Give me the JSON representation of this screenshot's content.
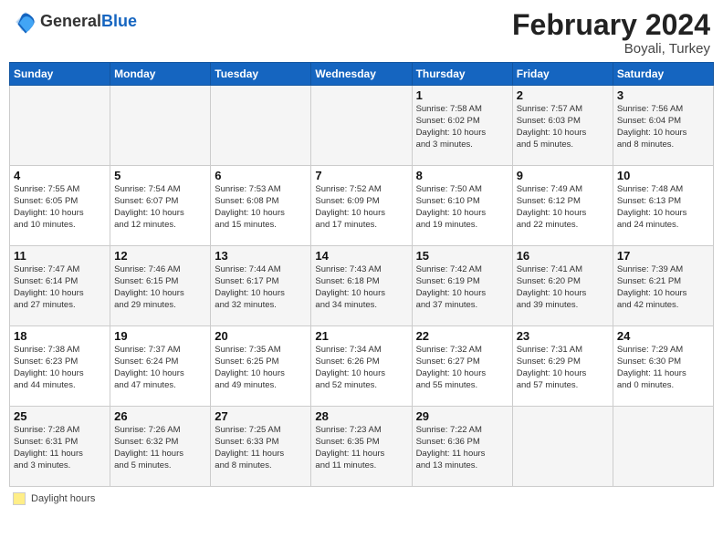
{
  "header": {
    "logo_general": "General",
    "logo_blue": "Blue",
    "month_year": "February 2024",
    "location": "Boyali, Turkey"
  },
  "legend": {
    "box_label": "Daylight hours"
  },
  "weekdays": [
    "Sunday",
    "Monday",
    "Tuesday",
    "Wednesday",
    "Thursday",
    "Friday",
    "Saturday"
  ],
  "weeks": [
    [
      {
        "day": "",
        "info": ""
      },
      {
        "day": "",
        "info": ""
      },
      {
        "day": "",
        "info": ""
      },
      {
        "day": "",
        "info": ""
      },
      {
        "day": "1",
        "info": "Sunrise: 7:58 AM\nSunset: 6:02 PM\nDaylight: 10 hours\nand 3 minutes."
      },
      {
        "day": "2",
        "info": "Sunrise: 7:57 AM\nSunset: 6:03 PM\nDaylight: 10 hours\nand 5 minutes."
      },
      {
        "day": "3",
        "info": "Sunrise: 7:56 AM\nSunset: 6:04 PM\nDaylight: 10 hours\nand 8 minutes."
      }
    ],
    [
      {
        "day": "4",
        "info": "Sunrise: 7:55 AM\nSunset: 6:05 PM\nDaylight: 10 hours\nand 10 minutes."
      },
      {
        "day": "5",
        "info": "Sunrise: 7:54 AM\nSunset: 6:07 PM\nDaylight: 10 hours\nand 12 minutes."
      },
      {
        "day": "6",
        "info": "Sunrise: 7:53 AM\nSunset: 6:08 PM\nDaylight: 10 hours\nand 15 minutes."
      },
      {
        "day": "7",
        "info": "Sunrise: 7:52 AM\nSunset: 6:09 PM\nDaylight: 10 hours\nand 17 minutes."
      },
      {
        "day": "8",
        "info": "Sunrise: 7:50 AM\nSunset: 6:10 PM\nDaylight: 10 hours\nand 19 minutes."
      },
      {
        "day": "9",
        "info": "Sunrise: 7:49 AM\nSunset: 6:12 PM\nDaylight: 10 hours\nand 22 minutes."
      },
      {
        "day": "10",
        "info": "Sunrise: 7:48 AM\nSunset: 6:13 PM\nDaylight: 10 hours\nand 24 minutes."
      }
    ],
    [
      {
        "day": "11",
        "info": "Sunrise: 7:47 AM\nSunset: 6:14 PM\nDaylight: 10 hours\nand 27 minutes."
      },
      {
        "day": "12",
        "info": "Sunrise: 7:46 AM\nSunset: 6:15 PM\nDaylight: 10 hours\nand 29 minutes."
      },
      {
        "day": "13",
        "info": "Sunrise: 7:44 AM\nSunset: 6:17 PM\nDaylight: 10 hours\nand 32 minutes."
      },
      {
        "day": "14",
        "info": "Sunrise: 7:43 AM\nSunset: 6:18 PM\nDaylight: 10 hours\nand 34 minutes."
      },
      {
        "day": "15",
        "info": "Sunrise: 7:42 AM\nSunset: 6:19 PM\nDaylight: 10 hours\nand 37 minutes."
      },
      {
        "day": "16",
        "info": "Sunrise: 7:41 AM\nSunset: 6:20 PM\nDaylight: 10 hours\nand 39 minutes."
      },
      {
        "day": "17",
        "info": "Sunrise: 7:39 AM\nSunset: 6:21 PM\nDaylight: 10 hours\nand 42 minutes."
      }
    ],
    [
      {
        "day": "18",
        "info": "Sunrise: 7:38 AM\nSunset: 6:23 PM\nDaylight: 10 hours\nand 44 minutes."
      },
      {
        "day": "19",
        "info": "Sunrise: 7:37 AM\nSunset: 6:24 PM\nDaylight: 10 hours\nand 47 minutes."
      },
      {
        "day": "20",
        "info": "Sunrise: 7:35 AM\nSunset: 6:25 PM\nDaylight: 10 hours\nand 49 minutes."
      },
      {
        "day": "21",
        "info": "Sunrise: 7:34 AM\nSunset: 6:26 PM\nDaylight: 10 hours\nand 52 minutes."
      },
      {
        "day": "22",
        "info": "Sunrise: 7:32 AM\nSunset: 6:27 PM\nDaylight: 10 hours\nand 55 minutes."
      },
      {
        "day": "23",
        "info": "Sunrise: 7:31 AM\nSunset: 6:29 PM\nDaylight: 10 hours\nand 57 minutes."
      },
      {
        "day": "24",
        "info": "Sunrise: 7:29 AM\nSunset: 6:30 PM\nDaylight: 11 hours\nand 0 minutes."
      }
    ],
    [
      {
        "day": "25",
        "info": "Sunrise: 7:28 AM\nSunset: 6:31 PM\nDaylight: 11 hours\nand 3 minutes."
      },
      {
        "day": "26",
        "info": "Sunrise: 7:26 AM\nSunset: 6:32 PM\nDaylight: 11 hours\nand 5 minutes."
      },
      {
        "day": "27",
        "info": "Sunrise: 7:25 AM\nSunset: 6:33 PM\nDaylight: 11 hours\nand 8 minutes."
      },
      {
        "day": "28",
        "info": "Sunrise: 7:23 AM\nSunset: 6:35 PM\nDaylight: 11 hours\nand 11 minutes."
      },
      {
        "day": "29",
        "info": "Sunrise: 7:22 AM\nSunset: 6:36 PM\nDaylight: 11 hours\nand 13 minutes."
      },
      {
        "day": "",
        "info": ""
      },
      {
        "day": "",
        "info": ""
      }
    ]
  ]
}
